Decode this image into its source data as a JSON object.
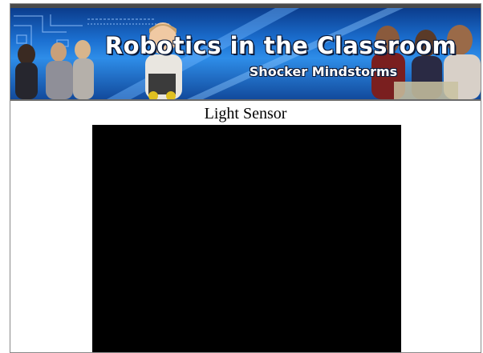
{
  "banner": {
    "title": "Robotics in the Classroom",
    "subtitle": "Shocker Mindstorms",
    "colors": {
      "background_dark": "#0b3c8c",
      "background_light": "#2e8de8",
      "text": "#ffffff"
    }
  },
  "page": {
    "heading": "Light Sensor"
  },
  "video": {
    "state": "blank",
    "color": "#000000"
  }
}
